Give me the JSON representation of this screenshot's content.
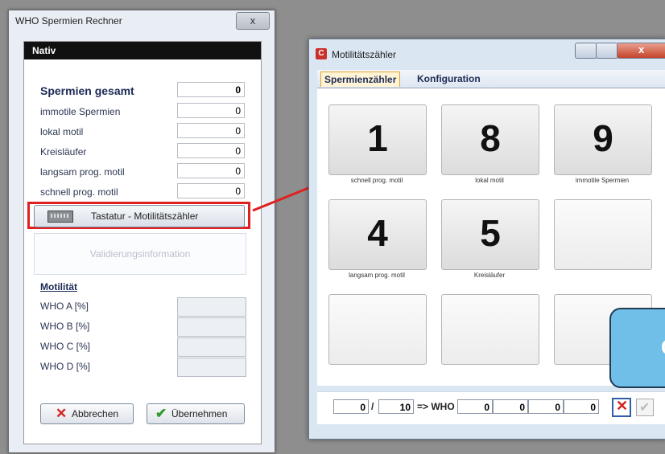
{
  "left_window": {
    "title": "WHO Spermien Rechner",
    "close_label": "x",
    "section_header": "Nativ",
    "counts": [
      {
        "label": "Spermien gesamt",
        "value": "0"
      },
      {
        "label": "immotile Spermien",
        "value": "0"
      },
      {
        "label": "lokal motil",
        "value": "0"
      },
      {
        "label": "Kreisläufer",
        "value": "0"
      },
      {
        "label": "langsam prog. motil",
        "value": "0"
      },
      {
        "label": "schnell prog. motil",
        "value": "0"
      }
    ],
    "keyboard_button": "Tastatur - Motilitätszähler",
    "validation_placeholder": "Validierungsinformation",
    "motility_heading": "Motilität",
    "who_rows": [
      "WHO A [%]",
      "WHO B [%]",
      "WHO C [%]",
      "WHO D [%]"
    ],
    "cancel_button": "Abbrechen",
    "apply_button": "Übernehmen"
  },
  "right_window": {
    "title": "Motilitätszähler",
    "app_icon": "C",
    "tabs": [
      "Spermienzähler",
      "Konfiguration"
    ],
    "keys": [
      {
        "number": "1",
        "label": "schnell prog. motil"
      },
      {
        "number": "8",
        "label": "lokal motil"
      },
      {
        "number": "9",
        "label": "immotile Spermien"
      },
      {
        "number": "4",
        "label": "langsam prog. motil"
      },
      {
        "number": "5",
        "label": "Kreisläufer"
      }
    ],
    "counter_value": "0",
    "counter_separator": "/",
    "counter_total": "10",
    "who_arrow": "=> WHO",
    "who_values": [
      "0",
      "0",
      "0",
      "0"
    ]
  },
  "overlay_text": "C",
  "colors": {
    "highlight": "#e02020",
    "active_tab": "#fff4d6",
    "overlay": "#6fbfe8"
  }
}
